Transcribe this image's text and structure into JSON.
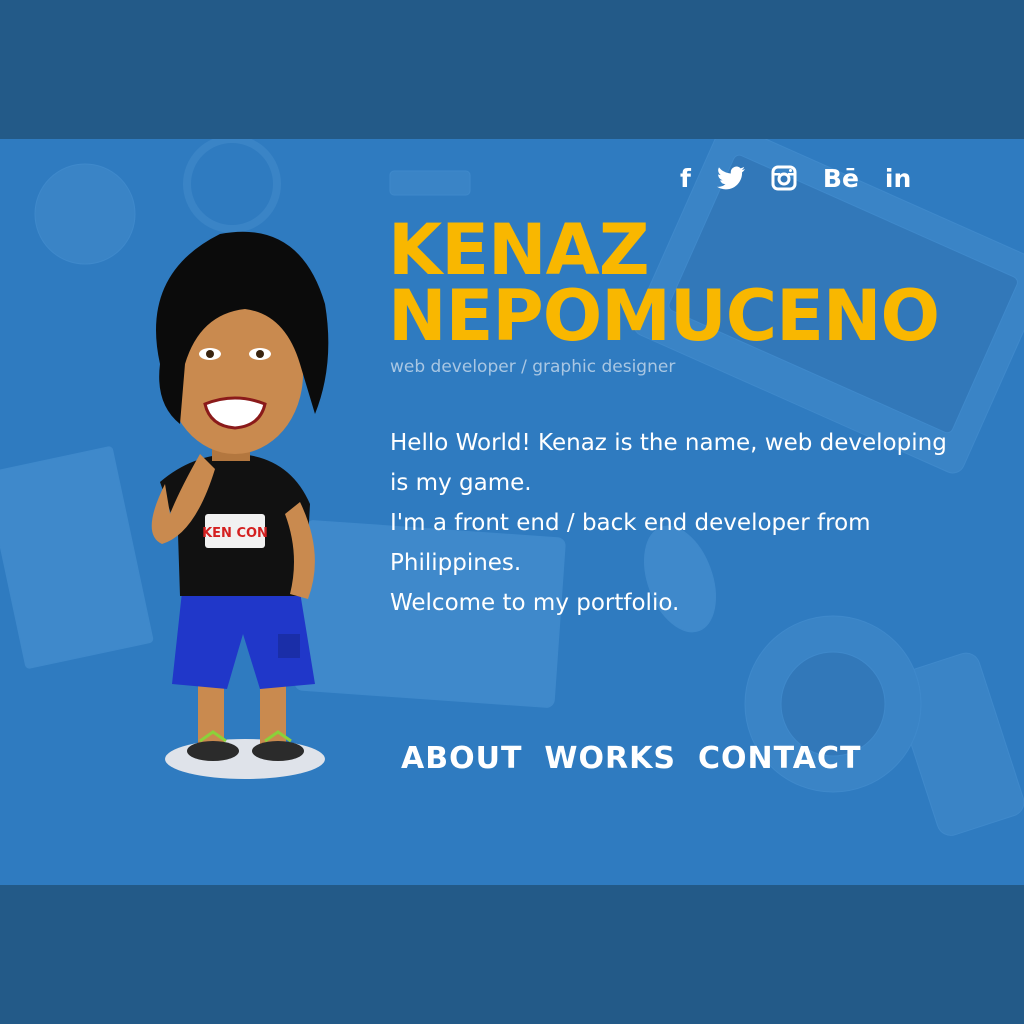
{
  "social": [
    {
      "icon": "facebook-icon",
      "label": "f"
    },
    {
      "icon": "twitter-icon",
      "label": ""
    },
    {
      "icon": "instagram-icon",
      "label": ""
    },
    {
      "icon": "behance-icon",
      "label": "Bē"
    },
    {
      "icon": "linkedin-icon",
      "label": "in"
    }
  ],
  "header": {
    "name_line1": "KENAZ",
    "name_line2": "NEPOMUCENO",
    "subtitle": "web developer / graphic designer"
  },
  "intro": {
    "line1": "Hello World! Kenaz is the name, web developing is my game.",
    "line2": "I'm a front end / back end developer from Philippines.",
    "line3": "Welcome to my portfolio."
  },
  "nav": {
    "about": "ABOUT",
    "works": "WORKS",
    "contact": "CONTACT"
  },
  "avatar": {
    "shirt_text": "KEN CON"
  },
  "colors": {
    "page_band": "#235a88",
    "hero_bg": "#2f7bc0",
    "name": "#f9b700",
    "subtitle": "#a9c7e3",
    "text": "#ffffff"
  }
}
